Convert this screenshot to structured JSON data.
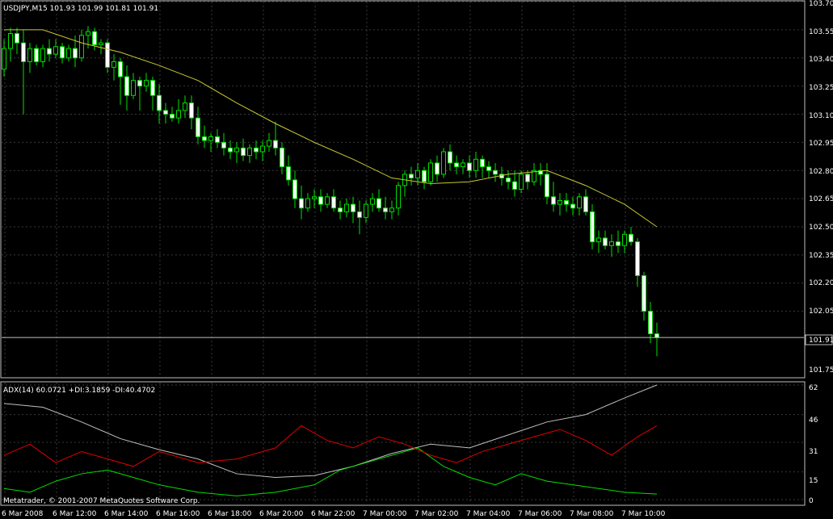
{
  "main_header": "USDJPY,M15  101.93 101.99 101.81 101.91",
  "indicator_header": "ADX(14) 60.0721 +DI:3.1859 -DI:40.4702",
  "copyright": "Metatrader, © 2001-2007 MetaQuotes Software Corp.",
  "price_axis_labels": [
    "103.70",
    "103.55",
    "103.40",
    "103.25",
    "103.10",
    "102.95",
    "102.80",
    "102.65",
    "102.50",
    "102.35",
    "102.20",
    "102.05",
    "101.91",
    "101.75"
  ],
  "adx_axis_labels": [
    "62",
    "46",
    "31",
    "15",
    "0"
  ],
  "time_labels": [
    "6 Mar 2008",
    "6 Mar 12:00",
    "6 Mar 14:00",
    "6 Mar 16:00",
    "6 Mar 18:00",
    "6 Mar 20:00",
    "6 Mar 22:00",
    "7 Mar 00:00",
    "7 Mar 02:00",
    "7 Mar 04:00",
    "7 Mar 06:00",
    "7 Mar 08:00",
    "7 Mar 10:00"
  ],
  "colors": {
    "background": "#000000",
    "grid": "#3a3a3a",
    "axis_text": "#ffffff",
    "bull_body": "#000000",
    "bull_border": "#00e000",
    "bear_body": "#ffffff",
    "wick": "#00e000",
    "ma_line": "#c8c832",
    "adx_line": "#c0c0c0",
    "plus_di": "#00e000",
    "minus_di": "#e00000",
    "current_price_line": "#c0c0c0"
  },
  "chart_data": [
    {
      "type": "candlestick",
      "symbol": "USDJPY",
      "timeframe": "M15",
      "header_ohlc": {
        "open": 101.93,
        "high": 101.99,
        "low": 101.81,
        "close": 101.91
      },
      "current_price": 101.91,
      "ylim": [
        101.7,
        103.7
      ],
      "y_ticks": [
        101.75,
        102.05,
        102.2,
        102.35,
        102.5,
        102.65,
        102.8,
        102.95,
        103.1,
        103.25,
        103.4,
        103.55,
        103.7
      ],
      "x_ticks": [
        "6 Mar 2008",
        "6 Mar 12:00",
        "6 Mar 14:00",
        "6 Mar 16:00",
        "6 Mar 18:00",
        "6 Mar 20:00",
        "6 Mar 22:00",
        "7 Mar 00:00",
        "7 Mar 02:00",
        "7 Mar 04:00",
        "7 Mar 06:00",
        "7 Mar 08:00",
        "7 Mar 10:00"
      ],
      "grid": true,
      "bars_per_label": 8,
      "candles": [
        [
          103.34,
          103.5,
          103.3,
          103.45
        ],
        [
          103.45,
          103.56,
          103.38,
          103.53
        ],
        [
          103.53,
          103.56,
          103.42,
          103.48
        ],
        [
          103.48,
          103.55,
          103.1,
          103.38
        ],
        [
          103.38,
          103.48,
          103.32,
          103.45
        ],
        [
          103.45,
          103.47,
          103.36,
          103.38
        ],
        [
          103.38,
          103.47,
          103.35,
          103.45
        ],
        [
          103.45,
          103.5,
          103.38,
          103.42
        ],
        [
          103.42,
          103.5,
          103.4,
          103.46
        ],
        [
          103.46,
          103.48,
          103.37,
          103.4
        ],
        [
          103.4,
          103.47,
          103.38,
          103.45
        ],
        [
          103.45,
          103.52,
          103.35,
          103.4
        ],
        [
          103.4,
          103.55,
          103.38,
          103.52
        ],
        [
          103.52,
          103.57,
          103.45,
          103.54
        ],
        [
          103.54,
          103.56,
          103.44,
          103.47
        ],
        [
          103.47,
          103.5,
          103.42,
          103.48
        ],
        [
          103.48,
          103.5,
          103.32,
          103.35
        ],
        [
          103.35,
          103.42,
          103.28,
          103.38
        ],
        [
          103.38,
          103.4,
          103.15,
          103.3
        ],
        [
          103.3,
          103.36,
          103.12,
          103.2
        ],
        [
          103.2,
          103.32,
          103.18,
          103.28
        ],
        [
          103.28,
          103.3,
          103.12,
          103.25
        ],
        [
          103.25,
          103.32,
          103.22,
          103.28
        ],
        [
          103.28,
          103.3,
          103.12,
          103.2
        ],
        [
          103.2,
          103.26,
          103.05,
          103.12
        ],
        [
          103.12,
          103.16,
          103.05,
          103.1
        ],
        [
          103.1,
          103.14,
          103.06,
          103.08
        ],
        [
          103.08,
          103.18,
          103.05,
          103.12
        ],
        [
          103.12,
          103.2,
          103.08,
          103.16
        ],
        [
          103.16,
          103.2,
          103.02,
          103.08
        ],
        [
          103.08,
          103.14,
          102.94,
          102.98
        ],
        [
          102.98,
          103.04,
          102.92,
          102.96
        ],
        [
          102.96,
          103.0,
          102.9,
          102.98
        ],
        [
          102.98,
          103.02,
          102.92,
          102.95
        ],
        [
          102.95,
          103.0,
          102.88,
          102.92
        ],
        [
          102.92,
          102.96,
          102.86,
          102.9
        ],
        [
          102.9,
          102.95,
          102.84,
          102.92
        ],
        [
          102.92,
          102.97,
          102.85,
          102.88
        ],
        [
          102.88,
          102.94,
          102.84,
          102.92
        ],
        [
          102.92,
          102.96,
          102.86,
          102.9
        ],
        [
          102.9,
          102.96,
          102.85,
          102.93
        ],
        [
          102.93,
          103.0,
          102.9,
          102.96
        ],
        [
          102.96,
          103.06,
          102.88,
          102.92
        ],
        [
          102.92,
          102.95,
          102.78,
          102.82
        ],
        [
          102.82,
          102.88,
          102.72,
          102.75
        ],
        [
          102.75,
          102.8,
          102.6,
          102.65
        ],
        [
          102.65,
          102.72,
          102.54,
          102.6
        ],
        [
          102.6,
          102.68,
          102.58,
          102.65
        ],
        [
          102.65,
          102.7,
          102.6,
          102.66
        ],
        [
          102.66,
          102.7,
          102.58,
          102.62
        ],
        [
          102.62,
          102.68,
          102.6,
          102.66
        ],
        [
          102.66,
          102.7,
          102.58,
          102.6
        ],
        [
          102.6,
          102.64,
          102.54,
          102.58
        ],
        [
          102.58,
          102.65,
          102.55,
          102.62
        ],
        [
          102.62,
          102.66,
          102.52,
          102.58
        ],
        [
          102.58,
          102.64,
          102.46,
          102.55
        ],
        [
          102.55,
          102.64,
          102.52,
          102.62
        ],
        [
          102.62,
          102.68,
          102.58,
          102.65
        ],
        [
          102.65,
          102.7,
          102.58,
          102.6
        ],
        [
          102.6,
          102.66,
          102.54,
          102.58
        ],
        [
          102.58,
          102.64,
          102.54,
          102.6
        ],
        [
          102.6,
          102.74,
          102.56,
          102.72
        ],
        [
          102.72,
          102.8,
          102.66,
          102.78
        ],
        [
          102.78,
          102.82,
          102.72,
          102.76
        ],
        [
          102.76,
          102.84,
          102.72,
          102.8
        ],
        [
          102.8,
          102.82,
          102.7,
          102.74
        ],
        [
          102.74,
          102.86,
          102.72,
          102.84
        ],
        [
          102.84,
          102.88,
          102.74,
          102.78
        ],
        [
          102.78,
          102.92,
          102.76,
          102.9
        ],
        [
          102.9,
          102.94,
          102.8,
          102.84
        ],
        [
          102.84,
          102.88,
          102.78,
          102.82
        ],
        [
          102.82,
          102.86,
          102.78,
          102.84
        ],
        [
          102.84,
          102.88,
          102.76,
          102.8
        ],
        [
          102.8,
          102.9,
          102.76,
          102.86
        ],
        [
          102.86,
          102.88,
          102.76,
          102.82
        ],
        [
          102.82,
          102.85,
          102.76,
          102.8
        ],
        [
          102.8,
          102.84,
          102.74,
          102.78
        ],
        [
          102.78,
          102.82,
          102.72,
          102.76
        ],
        [
          102.76,
          102.8,
          102.7,
          102.74
        ],
        [
          102.74,
          102.8,
          102.66,
          102.7
        ],
        [
          102.7,
          102.8,
          102.68,
          102.78
        ],
        [
          102.78,
          102.8,
          102.7,
          102.74
        ],
        [
          102.74,
          102.84,
          102.72,
          102.8
        ],
        [
          102.8,
          102.84,
          102.72,
          102.78
        ],
        [
          102.78,
          102.84,
          102.62,
          102.66
        ],
        [
          102.66,
          102.74,
          102.58,
          102.62
        ],
        [
          102.62,
          102.68,
          102.56,
          102.64
        ],
        [
          102.64,
          102.68,
          102.58,
          102.62
        ],
        [
          102.62,
          102.66,
          102.56,
          102.6
        ],
        [
          102.6,
          102.68,
          102.56,
          102.66
        ],
        [
          102.66,
          102.7,
          102.56,
          102.58
        ],
        [
          102.58,
          102.62,
          102.38,
          102.42
        ],
        [
          102.42,
          102.48,
          102.36,
          102.44
        ],
        [
          102.44,
          102.48,
          102.38,
          102.4
        ],
        [
          102.4,
          102.46,
          102.34,
          102.42
        ],
        [
          102.42,
          102.48,
          102.36,
          102.4
        ],
        [
          102.4,
          102.48,
          102.36,
          102.46
        ],
        [
          102.46,
          102.5,
          102.4,
          102.42
        ],
        [
          102.42,
          102.44,
          102.18,
          102.24
        ],
        [
          102.24,
          102.26,
          102.0,
          102.05
        ],
        [
          102.05,
          102.1,
          101.88,
          101.93
        ],
        [
          101.93,
          101.99,
          101.81,
          101.91
        ]
      ],
      "ma_line": [
        [
          0,
          103.55
        ],
        [
          6,
          103.55
        ],
        [
          12,
          103.48
        ],
        [
          18,
          103.43
        ],
        [
          24,
          103.36
        ],
        [
          30,
          103.28
        ],
        [
          36,
          103.16
        ],
        [
          42,
          103.05
        ],
        [
          48,
          102.95
        ],
        [
          54,
          102.86
        ],
        [
          60,
          102.76
        ],
        [
          66,
          102.73
        ],
        [
          72,
          102.74
        ],
        [
          78,
          102.78
        ],
        [
          84,
          102.8
        ],
        [
          90,
          102.72
        ],
        [
          96,
          102.62
        ],
        [
          101,
          102.5
        ]
      ]
    },
    {
      "type": "line",
      "indicator": "ADX(14)",
      "current": {
        "adx": 60.0721,
        "plus_di": 3.1859,
        "minus_di": 40.4702
      },
      "ylim": [
        0,
        62
      ],
      "y_ticks": [
        0,
        15,
        31,
        46,
        62
      ],
      "series": [
        {
          "name": "ADX",
          "values": [
            [
              0,
              52
            ],
            [
              6,
              50
            ],
            [
              12,
              42
            ],
            [
              18,
              33
            ],
            [
              24,
              27
            ],
            [
              30,
              22
            ],
            [
              36,
              14
            ],
            [
              42,
              12
            ],
            [
              48,
              13
            ],
            [
              54,
              18
            ],
            [
              60,
              25
            ],
            [
              66,
              30
            ],
            [
              72,
              28
            ],
            [
              78,
              35
            ],
            [
              84,
              42
            ],
            [
              90,
              46
            ],
            [
              96,
              55
            ],
            [
              101,
              62
            ]
          ]
        },
        {
          "name": "+DI",
          "values": [
            [
              0,
              6
            ],
            [
              4,
              4
            ],
            [
              8,
              10
            ],
            [
              12,
              14
            ],
            [
              16,
              16
            ],
            [
              20,
              12
            ],
            [
              24,
              8
            ],
            [
              30,
              4
            ],
            [
              36,
              2
            ],
            [
              42,
              4
            ],
            [
              48,
              8
            ],
            [
              52,
              16
            ],
            [
              56,
              20
            ],
            [
              60,
              24
            ],
            [
              64,
              28
            ],
            [
              68,
              18
            ],
            [
              72,
              12
            ],
            [
              76,
              8
            ],
            [
              80,
              14
            ],
            [
              84,
              10
            ],
            [
              88,
              8
            ],
            [
              92,
              6
            ],
            [
              96,
              4
            ],
            [
              101,
              3
            ]
          ]
        },
        {
          "name": "-DI",
          "values": [
            [
              0,
              24
            ],
            [
              4,
              30
            ],
            [
              8,
              20
            ],
            [
              12,
              26
            ],
            [
              16,
              22
            ],
            [
              20,
              18
            ],
            [
              24,
              26
            ],
            [
              30,
              20
            ],
            [
              36,
              22
            ],
            [
              42,
              28
            ],
            [
              46,
              40
            ],
            [
              50,
              32
            ],
            [
              54,
              28
            ],
            [
              58,
              34
            ],
            [
              62,
              30
            ],
            [
              66,
              24
            ],
            [
              70,
              20
            ],
            [
              74,
              26
            ],
            [
              78,
              30
            ],
            [
              82,
              34
            ],
            [
              86,
              38
            ],
            [
              90,
              32
            ],
            [
              94,
              24
            ],
            [
              98,
              34
            ],
            [
              101,
              40
            ]
          ]
        }
      ]
    }
  ]
}
